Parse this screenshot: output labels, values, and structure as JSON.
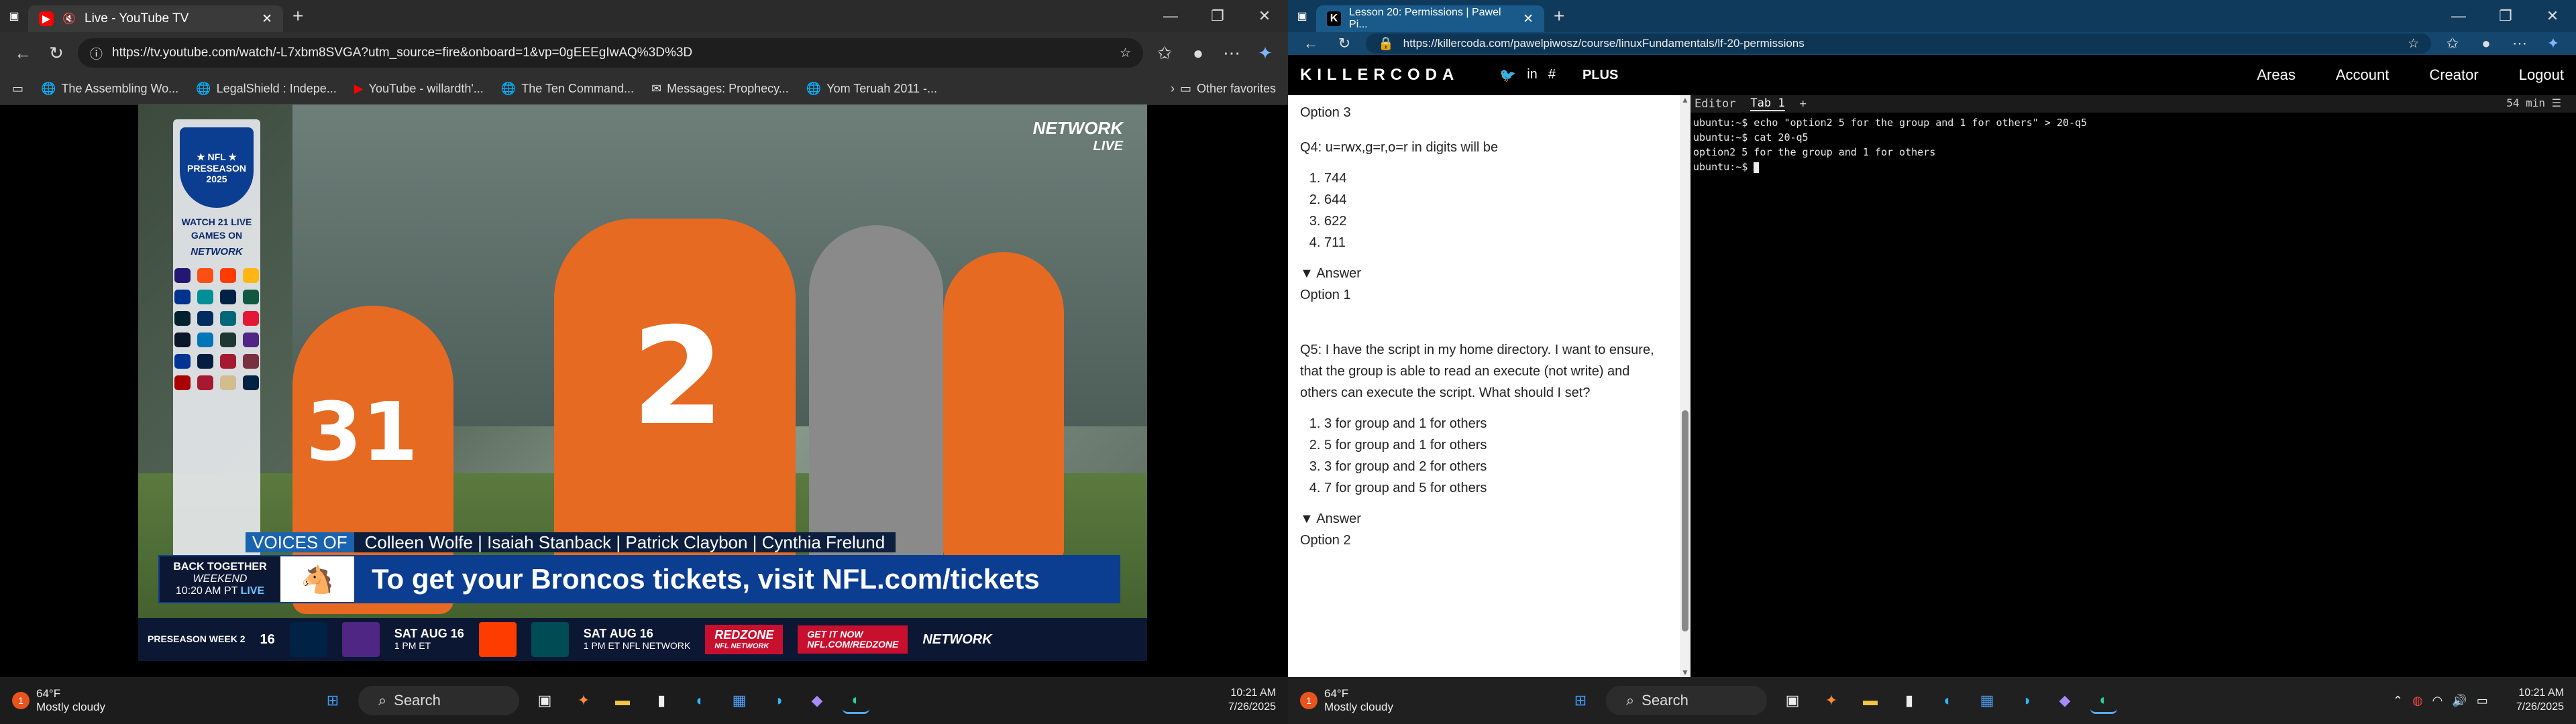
{
  "left_browser": {
    "tab_title": "Live - YouTube TV",
    "new_tab": "+",
    "url": "https://tv.youtube.com/watch/-L7xbm8SVGA?utm_source=fire&onboard=1&vp=0gEEEgIwAQ%3D%3D",
    "bookmarks": [
      "The Assembling Wo...",
      "LegalShield : Indepe...",
      "YouTube - willardth'...",
      "The Ten Command...",
      "Messages: Prophecy...",
      "Yom Teruah 2011 -..."
    ],
    "other_favorites": "Other favorites",
    "window_controls": [
      "—",
      "❐",
      "✕"
    ]
  },
  "video": {
    "panel": {
      "preseason_label": "PRESEASON",
      "year": "2025",
      "watch": "WATCH 21 LIVE GAMES ON",
      "network": "NETWORK"
    },
    "network_logo": {
      "top": "NETWORK",
      "bottom": "LIVE"
    },
    "jersey_numbers": [
      "31",
      "2"
    ],
    "voices_tag": "VOICES OF",
    "voices_names": "Colleen Wolfe | Isaiah Stanback | Patrick Claybon | Cynthia Frelund",
    "live_block": {
      "line1": "BACK TOGETHER",
      "line2": "WEEKEND",
      "time": "10:20 AM PT",
      "live": "LIVE"
    },
    "promo_text": "To get your Broncos tickets, visit NFL.com/tickets",
    "ticker": {
      "week_label": "PRESEASON WEEK 2",
      "week_num": "16",
      "game1_date": "SAT AUG 16",
      "game1_time": "1 PM ET",
      "game2_date": "SAT AUG 16",
      "game2_time": "1 PM ET NFL NETWORK",
      "redzone": "REDZONE",
      "redzone_sub": "NFL NETWORK",
      "get_it": "GET IT NOW",
      "get_it_url": "NFL.COM/REDZONE",
      "network": "NETWORK"
    }
  },
  "right_browser": {
    "tab_title": "Lesson 20: Permissions | Pawel Pi...",
    "url": "https://killercoda.com/pawelpiwosz/course/linuxFundamentals/lf-20-permissions",
    "window_controls": [
      "—",
      "❐",
      "✕"
    ]
  },
  "killercoda": {
    "logo": "KILLERCODA",
    "plus": "PLUS",
    "nav": [
      "Areas",
      "Account",
      "Creator",
      "Logout"
    ]
  },
  "lesson": {
    "prev_option": "Option 3",
    "q4": "Q4: u=rwx,g=r,o=r in digits will be",
    "q4_options": [
      "744",
      "644",
      "622",
      "711"
    ],
    "answer_label": "Answer",
    "q4_answer": "Option 1",
    "q5": "Q5: I have the script in my home directory. I want to ensure, that the group is able to read an execute (not write) and others can execute the script. What should I set?",
    "q5_options": [
      "3 for group and 1 for others",
      "5 for group and 1 for others",
      "3 for group and 2 for others",
      "7 for group and 5 for others"
    ],
    "q5_answer": "Option 2"
  },
  "terminal": {
    "tabs": [
      "Editor",
      "Tab 1",
      "+"
    ],
    "time_left": "54 min",
    "lines": [
      "ubuntu:~$ echo \"option2 5 for the group and 1 for others\" > 20-q5",
      "ubuntu:~$ cat 20-q5",
      "option2 5 for the group and 1 for others",
      "ubuntu:~$ "
    ]
  },
  "taskbar_left": {
    "temp": "64°F",
    "condition": "Mostly cloudy",
    "search": "Search",
    "time": "10:21 AM",
    "date": "7/26/2025"
  },
  "taskbar_right": {
    "temp": "64°F",
    "condition": "Mostly cloudy",
    "search": "Search",
    "time": "10:21 AM",
    "date": "7/26/2025"
  },
  "colors": {
    "youtube_red": "#ff0000",
    "edge_blue": "#0078d4",
    "nfl_blue": "#0b3d91",
    "broncos_orange": "#e66a21",
    "redzone_red": "#c8102e"
  }
}
